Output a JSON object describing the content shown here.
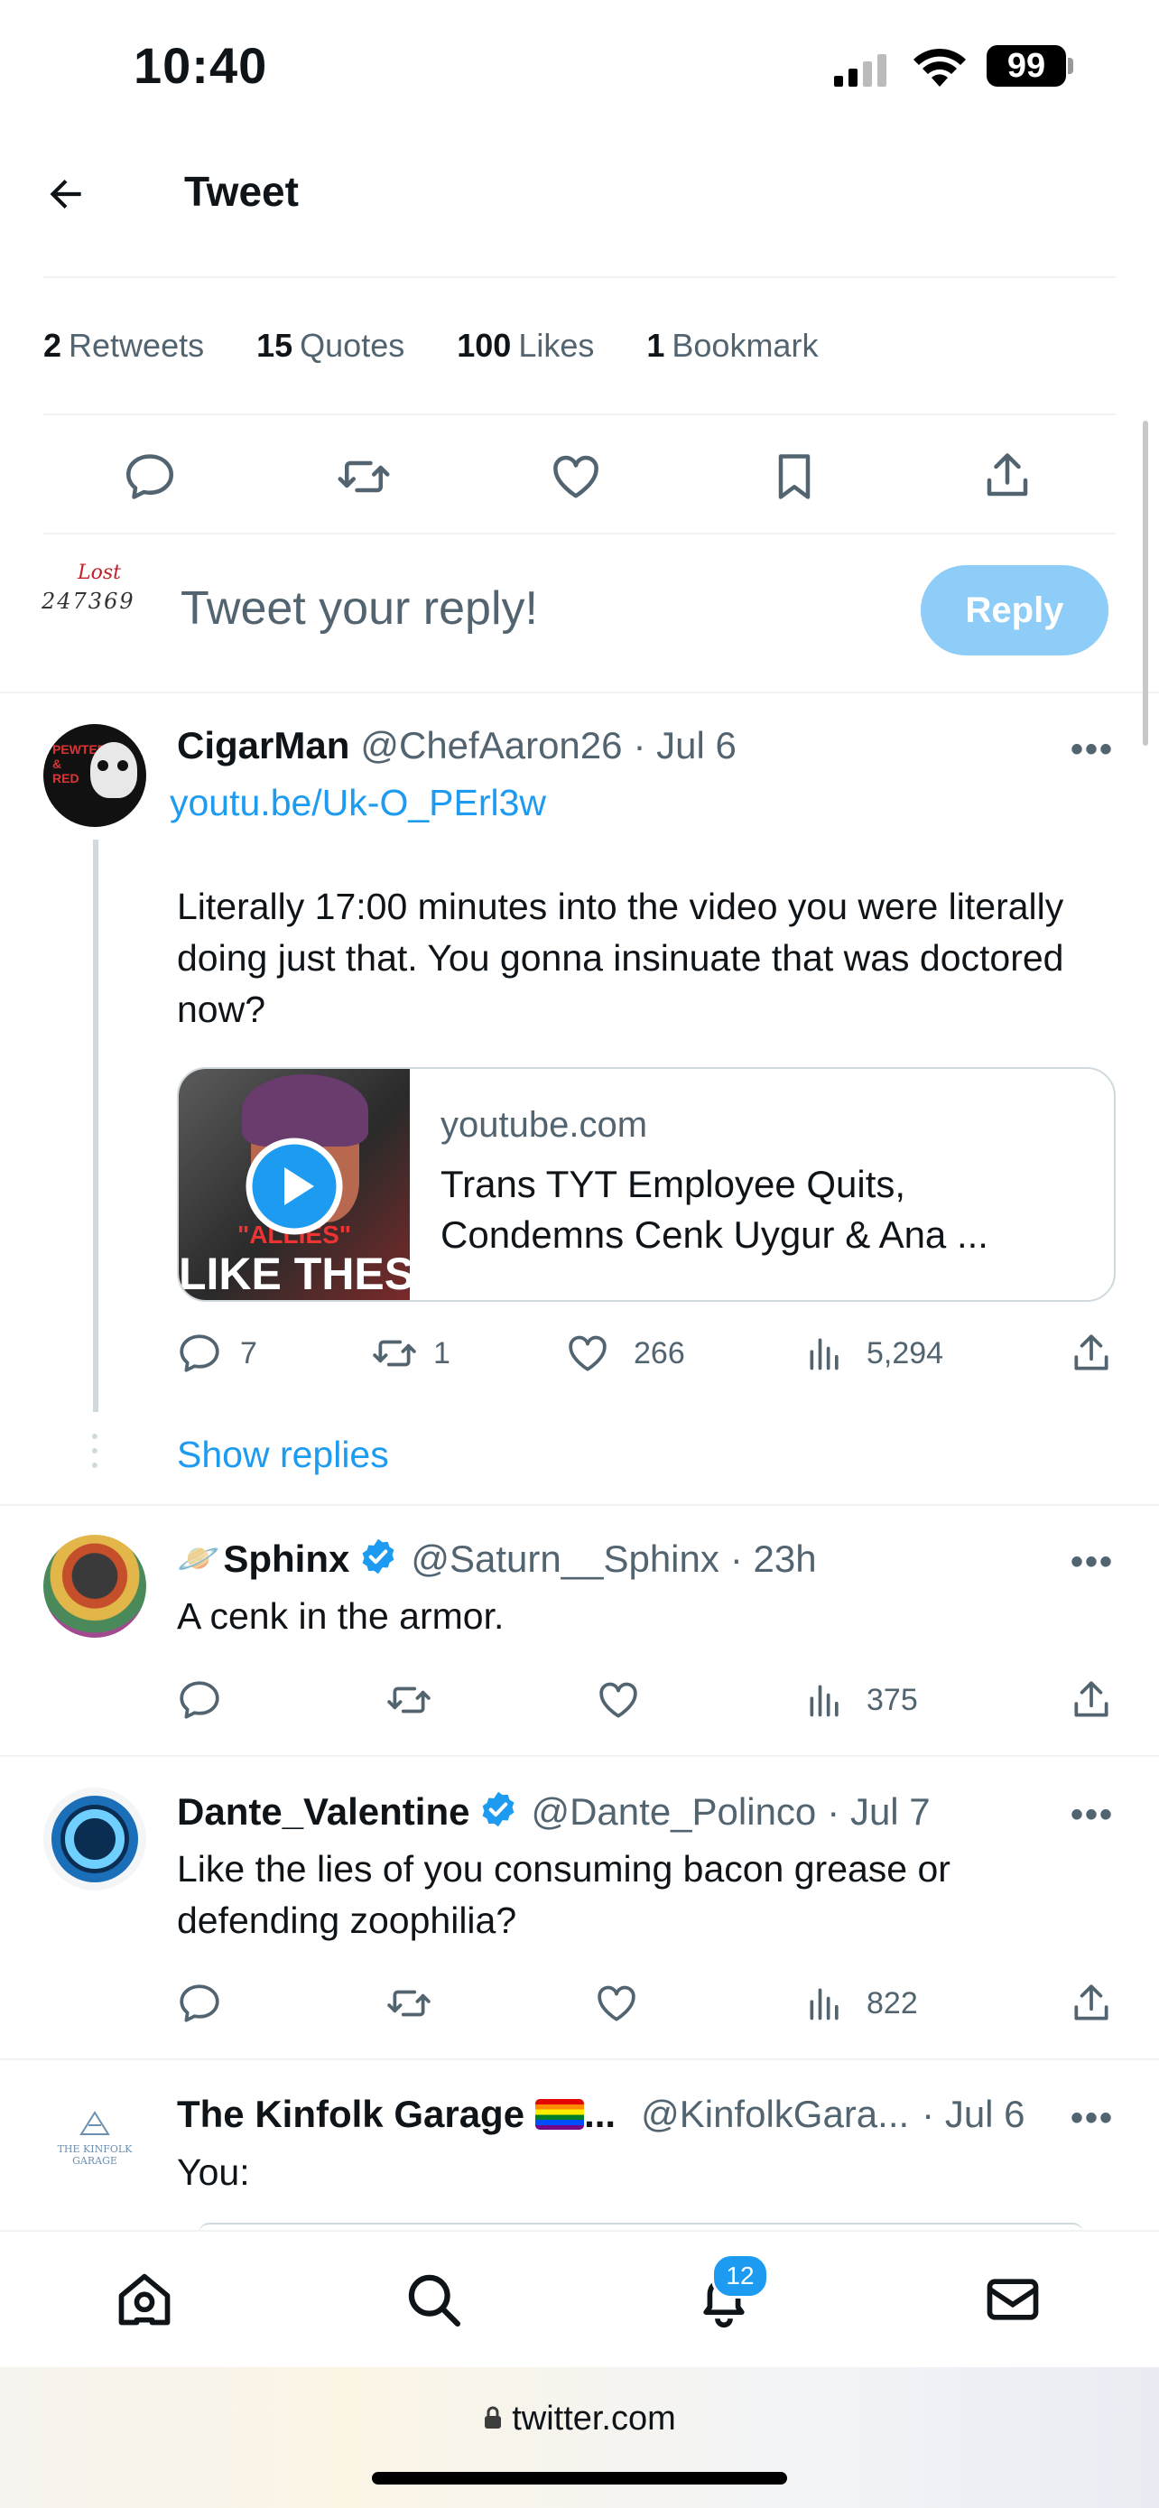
{
  "status_bar": {
    "time": "10:40",
    "battery": "99"
  },
  "header": {
    "title": "Tweet"
  },
  "stats": [
    {
      "count": "2",
      "label": "Retweets"
    },
    {
      "count": "15",
      "label": "Quotes"
    },
    {
      "count": "100",
      "label": "Likes"
    },
    {
      "count": "1",
      "label": "Bookmark"
    }
  ],
  "composer": {
    "avatar_text_top": "Lost",
    "avatar_text_bottom": "247369",
    "placeholder": "Tweet your reply!",
    "reply_label": "Reply"
  },
  "tweets": [
    {
      "name": "CigarMan",
      "handle": "@ChefAaron26",
      "time": "· Jul 6",
      "link": "youtu.be/Uk-O_PErl3w",
      "text": "Literally 17:00 minutes into the video you were literally doing just that. You gonna insinuate that was doctored now?",
      "card": {
        "domain": "youtube.com",
        "title": "Trans TYT Employee Quits, Condemns Cenk Uygur & Ana ...",
        "thumb_text_1": "\"ALLIES\"",
        "thumb_text_2": "LIKE THES"
      },
      "replies": "7",
      "retweets": "1",
      "likes": "266",
      "views": "5,294",
      "show_replies": "Show replies"
    },
    {
      "emoji": "🪐",
      "name": "Sphinx",
      "handle": "@Saturn__Sphinx",
      "time": "· 23h",
      "text": "A cenk in the armor.",
      "views": "375"
    },
    {
      "name": "Dante_Valentine",
      "handle": "@Dante_Polinco",
      "time": "· Jul 7",
      "text": "Like the lies of you consuming bacon grease or defending zoophilia?",
      "views": "822"
    },
    {
      "name": "The Kinfolk Garage",
      "name_suffix": "...",
      "handle": "@KinfolkGara...",
      "time": "· Jul 6",
      "avatar_text": "THE KINFOLK GARAGE",
      "text": "You:"
    }
  ],
  "nav": {
    "notifications_badge": "12"
  },
  "browser": {
    "url": "twitter.com"
  },
  "colors": {
    "accent": "#1d9bf0",
    "text": "#0f1419",
    "muted": "#536471",
    "reply_button": "#8ecdf8"
  }
}
